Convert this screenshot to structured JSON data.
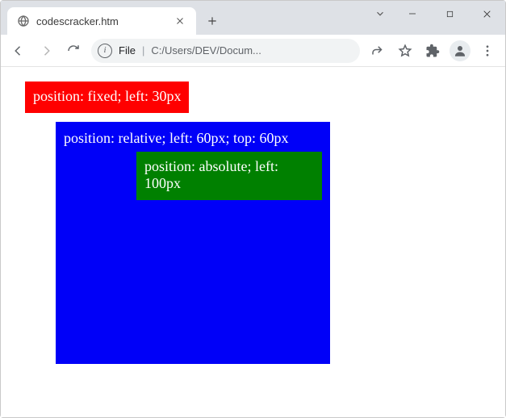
{
  "window": {
    "tab_title": "codescracker.htm"
  },
  "toolbar": {
    "omnibox_scheme": "File",
    "omnibox_path": "C:/Users/DEV/Docum..."
  },
  "page": {
    "fixed_text": "position: fixed; left: 30px",
    "relative_text": "position: relative; left: 60px; top: 60px",
    "absolute_text": "position: absolute; left: 100px"
  }
}
